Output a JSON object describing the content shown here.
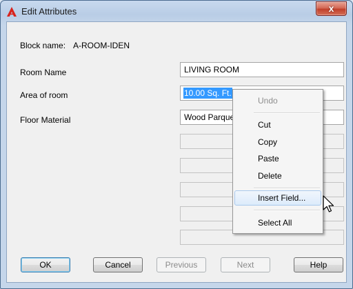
{
  "window": {
    "title": "Edit Attributes",
    "close_glyph": "x"
  },
  "block": {
    "label": "Block name:",
    "value": "A-ROOM-IDEN"
  },
  "attributes": [
    {
      "label": "Room Name",
      "value": "LIVING ROOM"
    },
    {
      "label": "Area of room",
      "value": "10.00 Sq. Ft."
    },
    {
      "label": "Floor Material",
      "value": "Wood Parque"
    }
  ],
  "buttons": {
    "ok": "OK",
    "cancel": "Cancel",
    "previous": "Previous",
    "next": "Next",
    "help": "Help"
  },
  "context_menu": {
    "undo": "Undo",
    "cut": "Cut",
    "copy": "Copy",
    "paste": "Paste",
    "delete": "Delete",
    "insert_field": "Insert Field...",
    "select_all": "Select All"
  },
  "colors": {
    "selection": "#3399ff",
    "close_button": "#c0402b",
    "app_icon": "#d8231c"
  },
  "icons": {
    "app": "autocad-a-icon",
    "close": "close-icon",
    "cursor": "mouse-pointer-icon"
  }
}
